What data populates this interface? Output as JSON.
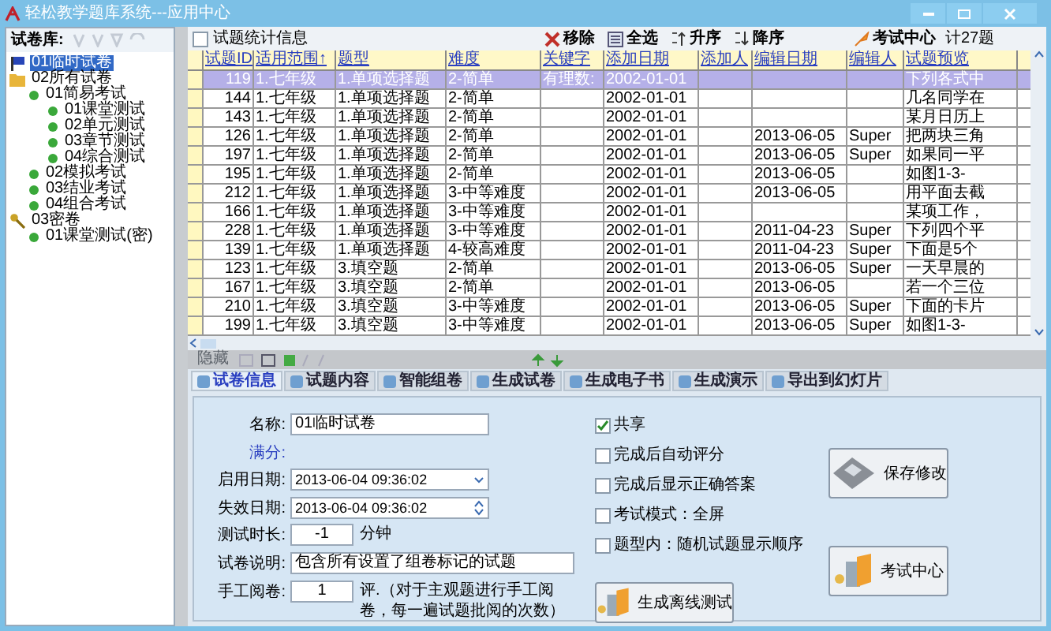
{
  "window": {
    "title": "轻松教学题库系统---应用中心"
  },
  "sidebar": {
    "label": "试卷库:",
    "tree": [
      {
        "label": "01临时试卷",
        "kind": "flag",
        "selected": true
      },
      {
        "label": "02所有试卷",
        "kind": "folder",
        "selected": false,
        "children": [
          {
            "label": "01简易考试",
            "kind": "leaf",
            "selected": false,
            "children": [
              {
                "label": "01课堂测试",
                "kind": "leaf",
                "selected": false
              },
              {
                "label": "02单元测试",
                "kind": "leaf",
                "selected": false
              },
              {
                "label": "03章节测试",
                "kind": "leaf",
                "selected": false
              },
              {
                "label": "04综合测试",
                "kind": "leaf",
                "selected": false
              }
            ]
          },
          {
            "label": "02模拟考试",
            "kind": "leaf",
            "selected": false
          },
          {
            "label": "03结业考试",
            "kind": "leaf",
            "selected": false
          },
          {
            "label": "04组合考试",
            "kind": "leaf",
            "selected": false
          }
        ]
      },
      {
        "label": "03密卷",
        "kind": "key",
        "selected": false,
        "children": [
          {
            "label": "01课堂测试(密)",
            "kind": "leaf",
            "selected": false
          }
        ]
      }
    ]
  },
  "toolbar": {
    "stats": {
      "label": "试题统计信息",
      "checked": false
    },
    "buttons": [
      {
        "label": "移除",
        "kind": "remove"
      },
      {
        "label": "全选",
        "kind": "select"
      },
      {
        "label": "升序",
        "kind": "asc"
      },
      {
        "label": "降序",
        "kind": "desc"
      }
    ],
    "exam": {
      "label": "考试中心"
    },
    "count": "计27题"
  },
  "table": {
    "columns": [
      "试题ID",
      "适用范围↑",
      "题型",
      "难度",
      "关键字",
      "添加日期",
      "添加人",
      "编辑日期",
      "编辑人",
      "试题预览"
    ],
    "rows": [
      {
        "selected": true,
        "cells": [
          "119",
          "1.七年级",
          "1.单项选择题",
          "2-简单",
          "有理数:",
          "2002-01-01",
          "",
          "",
          "",
          "下列各式中"
        ]
      },
      {
        "selected": false,
        "cells": [
          "144",
          "1.七年级",
          "1.单项选择题",
          "2-简单",
          "",
          "2002-01-01",
          "",
          "",
          "",
          "几名同学在"
        ]
      },
      {
        "selected": false,
        "cells": [
          "143",
          "1.七年级",
          "1.单项选择题",
          "2-简单",
          "",
          "2002-01-01",
          "",
          "",
          "",
          "某月日历上"
        ]
      },
      {
        "selected": false,
        "cells": [
          "126",
          "1.七年级",
          "1.单项选择题",
          "2-简单",
          "",
          "2002-01-01",
          "",
          "2013-06-05",
          "Super",
          "把两块三角"
        ]
      },
      {
        "selected": false,
        "cells": [
          "197",
          "1.七年级",
          "1.单项选择题",
          "2-简单",
          "",
          "2002-01-01",
          "",
          "2013-06-05",
          "Super",
          "如果同一平"
        ]
      },
      {
        "selected": false,
        "cells": [
          "195",
          "1.七年级",
          "1.单项选择题",
          "2-简单",
          "",
          "2002-01-01",
          "",
          "2013-06-05",
          "",
          "如图1-3-"
        ]
      },
      {
        "selected": false,
        "cells": [
          "212",
          "1.七年级",
          "1.单项选择题",
          "3-中等难度",
          "",
          "2002-01-01",
          "",
          "2013-06-05",
          "",
          "用平面去截"
        ]
      },
      {
        "selected": false,
        "cells": [
          "166",
          "1.七年级",
          "1.单项选择题",
          "3-中等难度",
          "",
          "2002-01-01",
          "",
          "",
          "",
          "某项工作，"
        ]
      },
      {
        "selected": false,
        "cells": [
          "228",
          "1.七年级",
          "1.单项选择题",
          "3-中等难度",
          "",
          "2002-01-01",
          "",
          "2011-04-23",
          "Super",
          "下列四个平"
        ]
      },
      {
        "selected": false,
        "cells": [
          "139",
          "1.七年级",
          "1.单项选择题",
          "4-较高难度",
          "",
          "2002-01-01",
          "",
          "2011-04-23",
          "Super",
          "下面是5个"
        ]
      },
      {
        "selected": false,
        "cells": [
          "123",
          "1.七年级",
          "3.填空题",
          "2-简单",
          "",
          "2002-01-01",
          "",
          "2013-06-05",
          "Super",
          "一天早晨的"
        ]
      },
      {
        "selected": false,
        "cells": [
          "167",
          "1.七年级",
          "3.填空题",
          "2-简单",
          "",
          "2002-01-01",
          "",
          "2013-06-05",
          "",
          "若一个三位"
        ]
      },
      {
        "selected": false,
        "cells": [
          "210",
          "1.七年级",
          "3.填空题",
          "3-中等难度",
          "",
          "2002-01-01",
          "",
          "2013-06-05",
          "Super",
          "下面的卡片"
        ]
      },
      {
        "selected": false,
        "cells": [
          "199",
          "1.七年级",
          "3.填空题",
          "3-中等难度",
          "",
          "2002-01-01",
          "",
          "2013-06-05",
          "Super",
          "如图1-3-"
        ]
      }
    ]
  },
  "strip": {
    "label": "隐藏",
    "disabled": true
  },
  "tabs": [
    {
      "label": "试卷信息",
      "selected": true
    },
    {
      "label": "试题内容",
      "selected": false
    },
    {
      "label": "智能组卷",
      "selected": false
    },
    {
      "label": "生成试卷",
      "selected": false
    },
    {
      "label": "生成电子书",
      "selected": false
    },
    {
      "label": "生成演示",
      "selected": false
    },
    {
      "label": "导出到幻灯片",
      "selected": false
    }
  ],
  "form": {
    "fields": [
      {
        "kind": "text",
        "label": "名称:",
        "value": "01临时试卷"
      },
      {
        "kind": "label",
        "label": "满分:"
      },
      {
        "kind": "date",
        "label": "启用日期:",
        "value": "2013-06-04 09:36:02"
      },
      {
        "kind": "spin",
        "label": "失效日期:",
        "value": "2013-06-04 09:36:02"
      },
      {
        "kind": "number",
        "label": "测试时长:",
        "value": "-1",
        "unit": "分钟"
      },
      {
        "kind": "wide",
        "label": "试卷说明:",
        "value": "包含所有设置了组卷标记的试题"
      },
      {
        "kind": "number",
        "label": "手工阅卷:",
        "value": "1",
        "unit": "评.（对于主观题进行手工阅卷，每一遍试题批阅的次数）"
      }
    ],
    "checkboxes": [
      {
        "label": "共享",
        "checked": true
      },
      {
        "label": "完成后自动评分",
        "checked": false
      },
      {
        "label": "完成后显示正确答案",
        "checked": false
      },
      {
        "label": "考试模式：全屏",
        "checked": false
      },
      {
        "label": "题型内：随机试题显示顺序",
        "checked": false
      }
    ],
    "buttons": [
      {
        "label": "保存修改",
        "kind": "save"
      },
      {
        "label": "生成离线测试",
        "kind": "offline"
      },
      {
        "label": "考试中心",
        "kind": "exam"
      }
    ]
  }
}
